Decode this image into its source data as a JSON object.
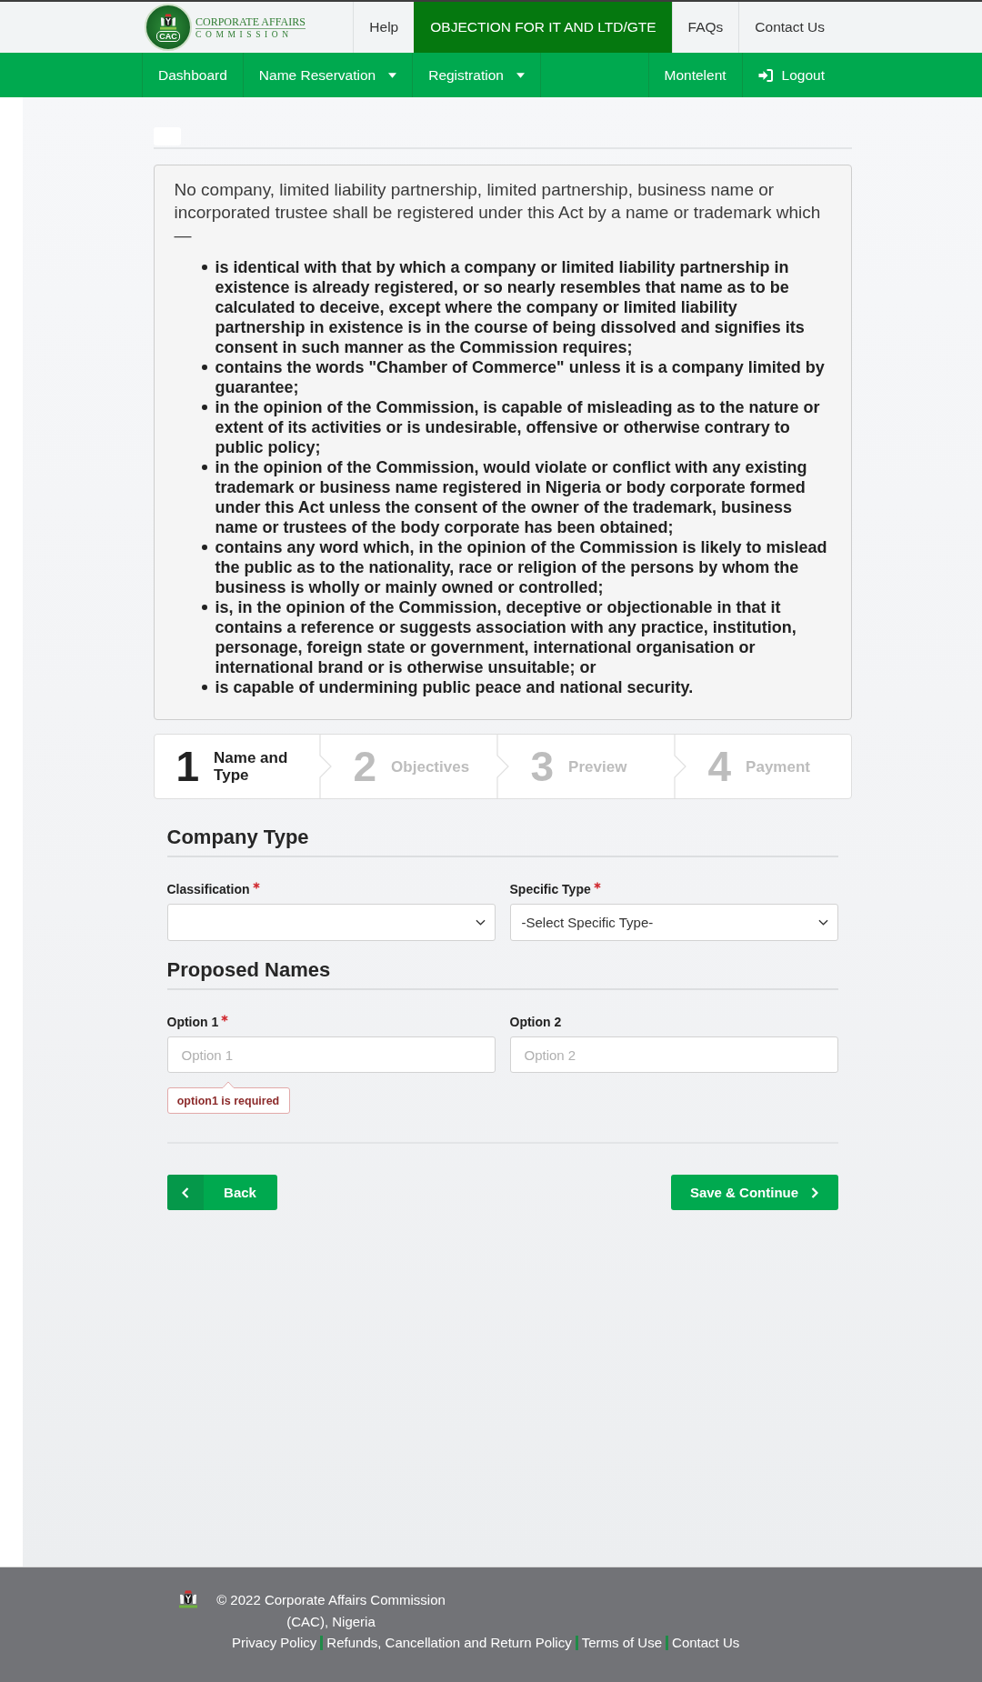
{
  "header": {
    "logo": {
      "badge": "CAC",
      "line_1": "CORPORATE AFFAIRS",
      "line_2": "COMMISSION"
    },
    "links": [
      {
        "label": "Help",
        "highlighted": false
      },
      {
        "label": "OBJECTION FOR IT AND LTD/GTE",
        "highlighted": true
      },
      {
        "label": "FAQs",
        "highlighted": false
      },
      {
        "label": "Contact Us",
        "highlighted": false
      }
    ]
  },
  "main_nav": {
    "left": [
      {
        "label": "Dashboard",
        "kind": "link"
      },
      {
        "label": "Name Reservation",
        "kind": "dropdown"
      },
      {
        "label": "Registration",
        "kind": "dropdown"
      }
    ],
    "right": [
      {
        "label": "Montelent",
        "kind": "link"
      },
      {
        "label": "Logout",
        "kind": "logout"
      }
    ]
  },
  "notice": {
    "intro": "No company, limited liability partnership, limited partnership, business name or incorporated trustee shall be registered under this Act by a name or trademark which —",
    "items": [
      "is identical with that by which a company or limited liability partnership in existence is already registered, or so nearly resembles that name as to be calculated to deceive, except where the company or limited liability partnership in existence is in the course of being dissolved and signifies its consent in such manner as the Commission requires;",
      "contains the words \"Chamber of Commerce\" unless it is a company limited by guarantee;",
      "in the opinion of the Commission, is capable of misleading as to the nature or extent of its activities or is undesirable, offensive or otherwise contrary to public policy;",
      "in the opinion of the Commission, would violate or conflict with any existing trademark or business name registered in Nigeria or body corporate formed under this Act unless the consent of the owner of the trademark, business name or trustees of the body corporate has been obtained;",
      "contains any word which, in the opinion of the Commission is likely to mislead the public as to the nationality, race or religion of the persons by whom the business is wholly or mainly owned or controlled;",
      "is, in the opinion of the Commission, deceptive or objectionable in that it contains a reference or suggests association with any practice, institution, personage, foreign state or government, international organisation or international brand or is otherwise unsuitable; or",
      "is capable of undermining public peace and national security."
    ]
  },
  "steps": [
    {
      "number": "1",
      "label": "Name and Type",
      "selected": true
    },
    {
      "number": "2",
      "label": "Objectives",
      "selected": false
    },
    {
      "number": "3",
      "label": "Preview",
      "selected": false
    },
    {
      "number": "4",
      "label": "Payment",
      "selected": false
    }
  ],
  "form": {
    "sections": [
      {
        "title": "Company Type",
        "fields": [
          {
            "label": "Classification",
            "kind": "select",
            "required": true
          },
          {
            "label": "Specific Type",
            "kind": "select",
            "required": true,
            "value": "-Select Specific Type-"
          }
        ]
      },
      {
        "title": "Proposed Names",
        "fields": [
          {
            "label": "Option 1",
            "kind": "input",
            "required": true,
            "placeholder": "Option 1",
            "error": "option1 is required"
          },
          {
            "label": "Option 2",
            "kind": "input",
            "required": false,
            "placeholder": "Option 2"
          }
        ]
      }
    ],
    "back_button": {
      "label": "Back"
    },
    "save_button": {
      "label": "Save & Continue"
    }
  },
  "footer": {
    "copyright": "© 2022 Corporate Affairs Commission (CAC), Nigeria",
    "links": [
      "Privacy Policy",
      "Refunds, Cancellation and Return Policy",
      "Terms of Use",
      "Contact Us"
    ]
  }
}
